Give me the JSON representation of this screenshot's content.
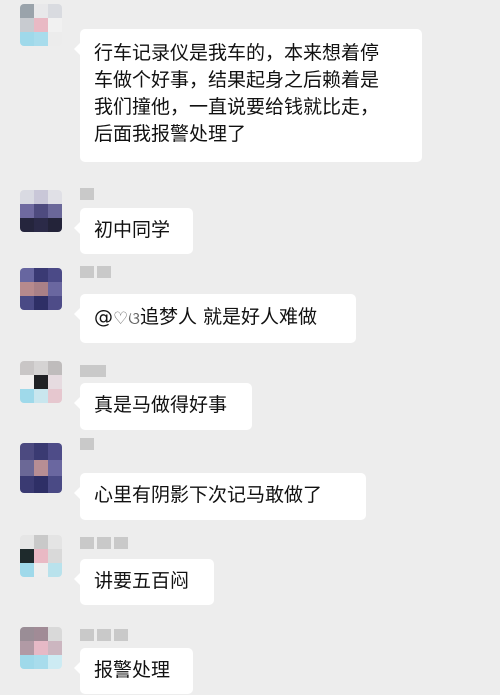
{
  "messages": [
    {
      "lines": [
        "行车记录仪是我车的，本来想着停",
        "车做个好事，结果起身之后赖着是",
        "我们撞他，一直说要给钱就比走，",
        "后面我报警处理了"
      ]
    },
    {
      "text": "初中同学"
    },
    {
      "mention_at": "@",
      "mention_name": "追梦人",
      "text": "就是好人难做"
    },
    {
      "text": "真是马做得好事"
    },
    {
      "text": "心里有阴影下次记马敢做了"
    },
    {
      "text": "讲要五百闷"
    },
    {
      "text": "报警处理"
    }
  ],
  "colors": {
    "background": "#ededed",
    "bubble": "#ffffff",
    "text": "#111111"
  },
  "icons": {
    "mention_decoration": "heart-doodle-icon"
  }
}
